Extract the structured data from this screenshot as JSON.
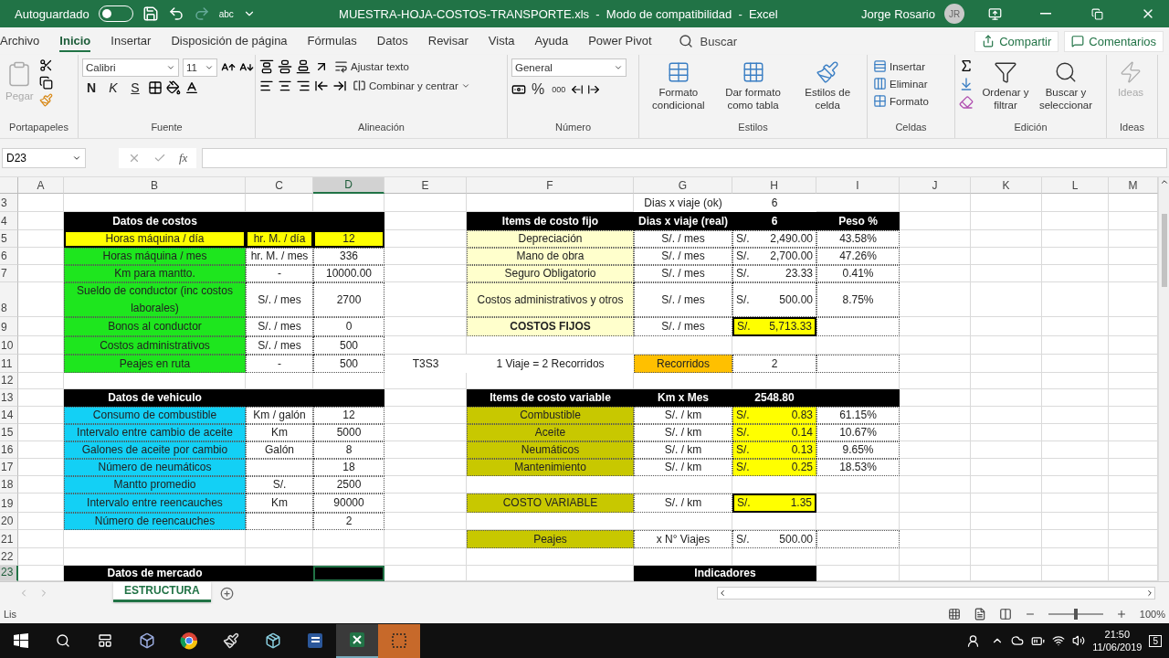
{
  "titlebar": {
    "autosave": {
      "label": "Autoguardado",
      "on": false
    },
    "spell": "abc",
    "title": "MUESTRA-HOJA-COSTOS-TRANSPORTE.xls  -  Modo de compatibilidad  -  Excel",
    "user": "Jorge Rosario",
    "initials": "JR"
  },
  "tabs": [
    {
      "label": "Archivo",
      "selected": false
    },
    {
      "label": "Inicio",
      "selected": true
    },
    {
      "label": "Insertar",
      "selected": false
    },
    {
      "label": "Disposición de página",
      "selected": false
    },
    {
      "label": "Fórmulas",
      "selected": false
    },
    {
      "label": "Datos",
      "selected": false
    },
    {
      "label": "Revisar",
      "selected": false
    },
    {
      "label": "Vista",
      "selected": false
    },
    {
      "label": "Ayuda",
      "selected": false
    },
    {
      "label": "Power Pivot",
      "selected": false
    }
  ],
  "search": {
    "placeholder": "Buscar"
  },
  "share": "Compartir",
  "comments": "Comentarios",
  "ribbon": {
    "clipboard": {
      "label": "Portapapeles",
      "paste": "Pegar",
      "disabled": true
    },
    "font": {
      "label": "Fuente",
      "font": "Calibri",
      "size": "11",
      "styles": [
        "N",
        "K",
        "S"
      ]
    },
    "alignment": {
      "label": "Alineación",
      "wrap": "Ajustar texto",
      "merge": "Combinar y centrar"
    },
    "number": {
      "label": "Número",
      "format": "General",
      "percent": "%",
      "thousands": "000"
    },
    "styles": {
      "label": "Estilos",
      "buttons": [
        "Formato condicional",
        "Dar formato como tabla",
        "Estilos de celda"
      ]
    },
    "cells": {
      "label": "Celdas",
      "buttons": [
        "Insertar",
        "Eliminar",
        "Formato"
      ]
    },
    "editing": {
      "label": "Edición",
      "buttons": [
        "Ordenar y filtrar",
        "Buscar y seleccionar"
      ]
    },
    "ideas": {
      "label": "Ideas",
      "button": "Ideas",
      "disabled": true
    }
  },
  "formula_bar": {
    "name_box": "D23",
    "fx": "fx"
  },
  "sheet": {
    "columns": [
      {
        "label": "A",
        "selected": false
      },
      {
        "label": "B",
        "selected": false
      },
      {
        "label": "C",
        "selected": false
      },
      {
        "label": "D",
        "selected": true
      },
      {
        "label": "E",
        "selected": false
      },
      {
        "label": "F",
        "selected": false
      },
      {
        "label": "G",
        "selected": false
      },
      {
        "label": "H",
        "selected": false
      },
      {
        "label": "I",
        "selected": false
      },
      {
        "label": "J",
        "selected": false
      },
      {
        "label": "K",
        "selected": false
      },
      {
        "label": "L",
        "selected": false
      },
      {
        "label": "M",
        "selected": false
      }
    ],
    "rows": [
      {
        "number": "3",
        "selected": false,
        "cells": {
          "G": {
            "text": "Dias x viaje (ok)",
            "kind": "plain"
          },
          "H": {
            "text": "6",
            "kind": "plain"
          }
        }
      },
      {
        "number": "4",
        "selected": false,
        "cells": {
          "B": {
            "text": "Datos de costos",
            "kind": "header"
          },
          "C": {
            "kind": "header"
          },
          "D": {
            "kind": "header"
          },
          "F": {
            "text": "Items de costo fijo",
            "kind": "header"
          },
          "G": {
            "text": "Dias x viaje (real)",
            "kind": "header"
          },
          "H": {
            "text": "6",
            "kind": "header"
          },
          "I": {
            "text": "Peso %",
            "kind": "header"
          }
        }
      },
      {
        "number": "5",
        "selected": false,
        "cells": {
          "B": {
            "text": "Horas máquina / día",
            "kind": "value",
            "color": "#ffff00",
            "outlined": true
          },
          "C": {
            "text": "hr. M. / día",
            "kind": "value",
            "color": "#ffff00",
            "outlined": true
          },
          "D": {
            "text": "12",
            "kind": "value",
            "color": "#ffff00",
            "outlined": true
          },
          "F": {
            "text": "Depreciación",
            "kind": "value",
            "color": "#ffffcc"
          },
          "G": {
            "text": "S/. / mes",
            "kind": "value"
          },
          "H": {
            "prefix": "S/.",
            "text": "2,490.00",
            "kind": "money"
          },
          "I": {
            "text": "43.58%",
            "kind": "value"
          }
        }
      },
      {
        "number": "6",
        "selected": false,
        "cells": {
          "B": {
            "text": "Horas máquina / mes",
            "kind": "value",
            "color": "#1ee61e"
          },
          "C": {
            "text": "hr. M. / mes",
            "kind": "value"
          },
          "D": {
            "text": "336",
            "kind": "value"
          },
          "F": {
            "text": "Mano de obra",
            "kind": "value",
            "color": "#ffffcc"
          },
          "G": {
            "text": "S/. / mes",
            "kind": "value"
          },
          "H": {
            "prefix": "S/.",
            "text": "2,700.00",
            "kind": "money"
          },
          "I": {
            "text": "47.26%",
            "kind": "value"
          }
        }
      },
      {
        "number": "7",
        "selected": false,
        "cells": {
          "B": {
            "text": "Km para mantto.",
            "kind": "value",
            "color": "#1ee61e"
          },
          "C": {
            "text": "-",
            "kind": "value"
          },
          "D": {
            "text": "10000.00",
            "kind": "value"
          },
          "F": {
            "text": "Seguro Obligatorio",
            "kind": "value",
            "color": "#ffffcc"
          },
          "G": {
            "text": "S/. / mes",
            "kind": "value"
          },
          "H": {
            "prefix": "S/.",
            "text": "23.33",
            "kind": "money"
          },
          "I": {
            "text": "0.41%",
            "kind": "value"
          }
        }
      },
      {
        "number": "8",
        "selected": false,
        "cells": {
          "B": {
            "text": "Sueldo de conductor (inc costos laborales)",
            "kind": "value",
            "color": "#1ee61e"
          },
          "C": {
            "text": "S/. / mes",
            "kind": "value"
          },
          "D": {
            "text": "2700",
            "kind": "value"
          },
          "F": {
            "text": "Costos administrativos y otros",
            "kind": "value",
            "color": "#ffffcc"
          },
          "G": {
            "text": "S/. / mes",
            "kind": "value"
          },
          "H": {
            "prefix": "S/.",
            "text": "500.00",
            "kind": "money"
          },
          "I": {
            "text": "8.75%",
            "kind": "value"
          }
        }
      },
      {
        "number": "9",
        "selected": false,
        "cells": {
          "B": {
            "text": "Bonos al conductor",
            "kind": "value",
            "color": "#1ee61e"
          },
          "C": {
            "text": "S/. / mes",
            "kind": "value"
          },
          "D": {
            "text": "0",
            "kind": "value"
          },
          "F": {
            "text": "COSTOS FIJOS",
            "kind": "total",
            "color": "#ffffcc"
          },
          "G": {
            "text": "S/. / mes",
            "kind": "value"
          },
          "H": {
            "prefix": "S/.",
            "text": "5,713.33",
            "kind": "money",
            "color": "#ffff00",
            "outlined": true
          },
          "I": {
            "kind": "value"
          }
        }
      },
      {
        "number": "10",
        "selected": false,
        "cells": {
          "B": {
            "text": "Costos administrativos",
            "kind": "value",
            "color": "#1ee61e"
          },
          "C": {
            "text": "S/. / mes",
            "kind": "value"
          },
          "D": {
            "text": "500",
            "kind": "value"
          }
        }
      },
      {
        "number": "11",
        "selected": false,
        "cells": {
          "B": {
            "text": "Peajes en ruta",
            "kind": "value",
            "color": "#1ee61e"
          },
          "C": {
            "text": "-",
            "kind": "value"
          },
          "D": {
            "text": "500",
            "kind": "value"
          },
          "E": {
            "text": "T3S3",
            "kind": "plain"
          },
          "F": {
            "text": "1 Viaje = 2 Recorridos",
            "kind": "plain"
          },
          "G": {
            "text": "Recorridos",
            "kind": "value",
            "color": "#ffc000"
          },
          "H": {
            "text": "2",
            "kind": "value"
          },
          "I": {
            "kind": "value"
          }
        }
      },
      {
        "number": "12",
        "selected": false
      },
      {
        "number": "13",
        "selected": false,
        "cells": {
          "B": {
            "text": "Datos de vehiculo",
            "kind": "header"
          },
          "C": {
            "kind": "header"
          },
          "D": {
            "kind": "header"
          },
          "F": {
            "text": "Items de costo variable",
            "kind": "header"
          },
          "G": {
            "text": "Km x Mes",
            "kind": "header"
          },
          "H": {
            "text": "2548.80",
            "kind": "header"
          },
          "I": {
            "kind": "header"
          }
        }
      },
      {
        "number": "14",
        "selected": false,
        "cells": {
          "B": {
            "text": "Consumo de combustible",
            "kind": "value",
            "color": "#13d0f5"
          },
          "C": {
            "text": "Km / galón",
            "kind": "value"
          },
          "D": {
            "text": "12",
            "kind": "value"
          },
          "F": {
            "text": "Combustible",
            "kind": "value",
            "color": "#c8c800"
          },
          "G": {
            "text": "S/. / km",
            "kind": "value"
          },
          "H": {
            "prefix": "S/.",
            "text": "0.83",
            "kind": "money",
            "color": "#ffff00"
          },
          "I": {
            "text": "61.15%",
            "kind": "value"
          }
        }
      },
      {
        "number": "15",
        "selected": false,
        "cells": {
          "B": {
            "text": "Intervalo entre cambio de aceite",
            "kind": "value",
            "color": "#13d0f5"
          },
          "C": {
            "text": "Km",
            "kind": "value"
          },
          "D": {
            "text": "5000",
            "kind": "value"
          },
          "F": {
            "text": "Aceite",
            "kind": "value",
            "color": "#c8c800"
          },
          "G": {
            "text": "S/. / km",
            "kind": "value"
          },
          "H": {
            "prefix": "S/.",
            "text": "0.14",
            "kind": "money",
            "color": "#ffff00"
          },
          "I": {
            "text": "10.67%",
            "kind": "value"
          }
        }
      },
      {
        "number": "16",
        "selected": false,
        "cells": {
          "B": {
            "text": "Galones de aceite por cambio",
            "kind": "value",
            "color": "#13d0f5"
          },
          "C": {
            "text": "Galón",
            "kind": "value"
          },
          "D": {
            "text": "8",
            "kind": "value"
          },
          "F": {
            "text": "Neumáticos",
            "kind": "value",
            "color": "#c8c800"
          },
          "G": {
            "text": "S/. / km",
            "kind": "value"
          },
          "H": {
            "prefix": "S/.",
            "text": "0.13",
            "kind": "money",
            "color": "#ffff00"
          },
          "I": {
            "text": "9.65%",
            "kind": "value"
          }
        }
      },
      {
        "number": "17",
        "selected": false,
        "cells": {
          "B": {
            "text": "Número de neumáticos",
            "kind": "value",
            "color": "#13d0f5"
          },
          "C": {
            "kind": "value"
          },
          "D": {
            "text": "18",
            "kind": "value"
          },
          "F": {
            "text": "Mantenimiento",
            "kind": "value",
            "color": "#c8c800"
          },
          "G": {
            "text": "S/. / km",
            "kind": "value"
          },
          "H": {
            "prefix": "S/.",
            "text": "0.25",
            "kind": "money",
            "color": "#ffff00"
          },
          "I": {
            "text": "18.53%",
            "kind": "value"
          }
        }
      },
      {
        "number": "18",
        "selected": false,
        "cells": {
          "B": {
            "text": "Mantto promedio",
            "kind": "value",
            "color": "#13d0f5"
          },
          "C": {
            "text": "S/.",
            "kind": "value"
          },
          "D": {
            "text": "2500",
            "kind": "value"
          }
        }
      },
      {
        "number": "19",
        "selected": false,
        "cells": {
          "B": {
            "text": "Intervalo entre reencauches",
            "kind": "value",
            "color": "#13d0f5"
          },
          "C": {
            "text": "Km",
            "kind": "value"
          },
          "D": {
            "text": "90000",
            "kind": "value"
          },
          "F": {
            "text": "COSTO VARIABLE",
            "kind": "value",
            "color": "#c8c800"
          },
          "G": {
            "text": "S/. / km",
            "kind": "value"
          },
          "H": {
            "prefix": "S/.",
            "text": "1.35",
            "kind": "money",
            "color": "#ffff00",
            "outlined": true
          }
        }
      },
      {
        "number": "20",
        "selected": false,
        "cells": {
          "B": {
            "text": "Número de reencauches",
            "kind": "value",
            "color": "#13d0f5"
          },
          "C": {
            "kind": "value"
          },
          "D": {
            "text": "2",
            "kind": "value"
          }
        }
      },
      {
        "number": "21",
        "selected": false,
        "cells": {
          "F": {
            "text": "Peajes",
            "kind": "value",
            "color": "#c8c800"
          },
          "G": {
            "text": "x N° Viajes",
            "kind": "value"
          },
          "H": {
            "prefix": "S/.",
            "text": "500.00",
            "kind": "money"
          },
          "I": {
            "kind": "value"
          }
        }
      },
      {
        "number": "22",
        "selected": false
      },
      {
        "number": "23",
        "selected": true,
        "cells": {
          "B": {
            "text": "Datos de mercado",
            "kind": "header"
          },
          "C": {
            "kind": "header"
          },
          "D": {
            "kind": "header"
          },
          "G": {
            "text": "Indicadores",
            "kind": "wide_header"
          }
        }
      }
    ]
  },
  "sheet_tabs": [
    {
      "label": "ESTRUCTURA",
      "selected": true
    }
  ],
  "status": {
    "text": "Lis",
    "zoom": "100%",
    "level": 0.5
  },
  "taskbar": {
    "time": "21:50",
    "date": "11/06/2019",
    "notifications": "5"
  }
}
